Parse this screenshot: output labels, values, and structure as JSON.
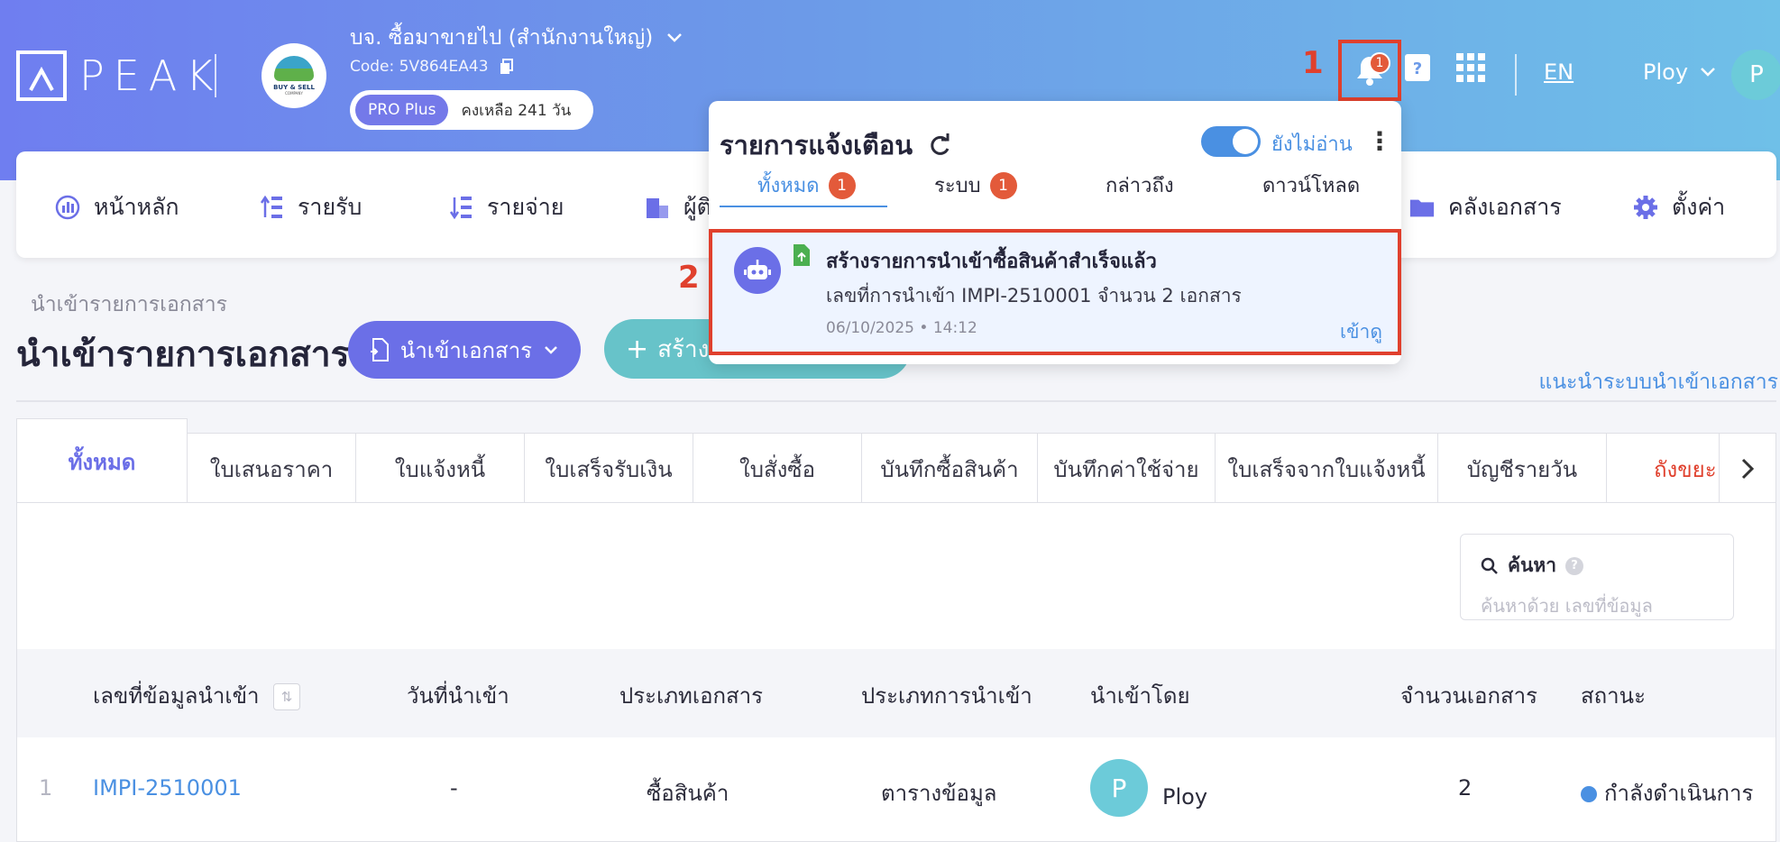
{
  "header": {
    "logo_text": "PEAK",
    "company_name": "บจ. ซื้อมาขายไป (สำนักงานใหญ่)",
    "company_code": "Code: 5V864EA43",
    "company_logo_text": "BUY & SELL",
    "company_logo_sub": "COMPANY",
    "plan_label": "PRO Plus",
    "plan_days_left": "คงเหลือ 241 วัน",
    "bell_badge": "1",
    "lang": "EN",
    "user_name": "Ploy",
    "user_initial": "P"
  },
  "annotations": {
    "step1": "1",
    "step2": "2"
  },
  "nav": {
    "items": [
      {
        "label": "หน้าหลัก",
        "icon": "dashboard-icon"
      },
      {
        "label": "รายรับ",
        "icon": "income-icon"
      },
      {
        "label": "รายจ่าย",
        "icon": "expense-icon"
      },
      {
        "label": "ผู้ติ",
        "icon": "contacts-icon"
      },
      {
        "label": "คลังเอกสาร",
        "icon": "folder-icon"
      },
      {
        "label": "ตั้งค่า",
        "icon": "gear-icon"
      }
    ]
  },
  "page": {
    "breadcrumb": "นำเข้ารายการเอกสาร",
    "title": "นำเข้ารายการเอกสาร",
    "import_button": "นำเข้าเอกสาร",
    "create_button": "สร้างเ",
    "guide_link": "แนะนำระบบนำเข้าเอกสาร"
  },
  "tabs": [
    "ทั้งหมด",
    "ใบเสนอราคา",
    "ใบแจ้งหนี้",
    "ใบเสร็จรับเงิน",
    "ใบสั่งซื้อ",
    "บันทึกซื้อสินค้า",
    "บันทึกค่าใช้จ่าย",
    "ใบเสร็จจากใบแจ้งหนี้",
    "บัญชีรายวัน",
    "ถังขยะ"
  ],
  "search": {
    "label": "ค้นหา",
    "help": "?",
    "placeholder": "ค้นหาด้วย เลขที่ข้อมูล"
  },
  "table": {
    "columns": [
      "เลขที่ข้อมูลนำเข้า",
      "วันที่นำเข้า",
      "ประเภทเอกสาร",
      "ประเภทการนำเข้า",
      "นำเข้าโดย",
      "จำนวนเอกสาร",
      "สถานะ"
    ],
    "rows": [
      {
        "index": "1",
        "id": "IMPI-2510001",
        "date": "-",
        "doc_type": "ซื้อสินค้า",
        "import_type": "ตารางข้อมูล",
        "by_initial": "P",
        "by": "Ploy",
        "count": "2",
        "status": "กำลังดำเนินการ"
      }
    ]
  },
  "notifications": {
    "title": "รายการแจ้งเตือน",
    "unread_toggle_label": "ยังไม่อ่าน",
    "tabs": [
      {
        "label": "ทั้งหมด",
        "badge": "1"
      },
      {
        "label": "ระบบ",
        "badge": "1"
      },
      {
        "label": "กล่าวถึง",
        "badge": ""
      },
      {
        "label": "ดาวน์โหลด",
        "badge": ""
      }
    ],
    "item": {
      "title": "สร้างรายการนำเข้าซื้อสินค้าสำเร็จแล้ว",
      "description": "เลขที่การนำเข้า IMPI-2510001 จำนวน 2 เอกสาร",
      "time": "06/10/2025 • 14:12",
      "action": "เข้าดู"
    }
  },
  "colors": {
    "accent": "#6b6fe7",
    "link": "#4a90e2",
    "highlight": "#e0402d",
    "badge": "#e35a3a",
    "teal": "#67c3c9"
  }
}
